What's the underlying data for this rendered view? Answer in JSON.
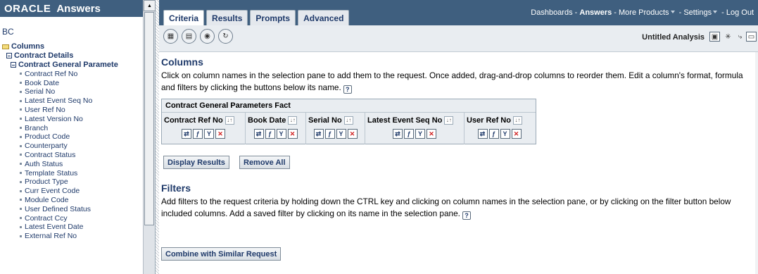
{
  "app": {
    "brand": "ORACLE",
    "product": "Answers",
    "subject_area": "BC"
  },
  "tree": {
    "root": "Columns",
    "folder": "Contract Details",
    "table": "Contract General Paramete",
    "columns": [
      "Contract Ref No",
      "Book Date",
      "Serial No",
      "Latest Event Seq No",
      "User Ref No",
      "Latest Version No",
      "Branch",
      "Product Code",
      "Counterparty",
      "Contract Status",
      "Auth Status",
      "Template Status",
      "Product Type",
      "Curr Event Code",
      "Module Code",
      "User Defined Status",
      "Contract Ccy",
      "Latest Event Date",
      "External Ref No"
    ]
  },
  "tabs": [
    "Criteria",
    "Results",
    "Prompts",
    "Advanced"
  ],
  "active_tab": "Criteria",
  "global_nav": {
    "dashboards": "Dashboards",
    "answers": "Answers",
    "more_products": "More Products",
    "settings": "Settings",
    "logout": "Log Out",
    "sep": " - "
  },
  "toolbar": {
    "analysis_name": "Untitled Analysis"
  },
  "columns_section": {
    "title": "Columns",
    "description": "Click on column names in the selection pane to add them to the request. Once added, drag-and-drop columns to reorder them. Edit a column's format, formula and filters by clicking the buttons below its name.",
    "fact_caption": "Contract General Parameters Fact",
    "criteria_columns": [
      "Contract Ref No",
      "Book Date",
      "Serial No",
      "Latest Event Seq No",
      "User Ref No"
    ],
    "display_results_label": "Display Results",
    "remove_all_label": "Remove All"
  },
  "filters_section": {
    "title": "Filters",
    "description": "Add filters to the request criteria by holding down the CTRL key and clicking on column names in the selection pane, or by clicking on the filter button below included columns. Add a saved filter by clicking on its name in the selection pane.",
    "combine_label": "Combine with Similar Request"
  },
  "colors": {
    "header_blue": "#3f5f7f",
    "text_navy": "#1f3a6a",
    "toolbar_gray": "#e9edf1",
    "delete_red": "#d02020"
  }
}
